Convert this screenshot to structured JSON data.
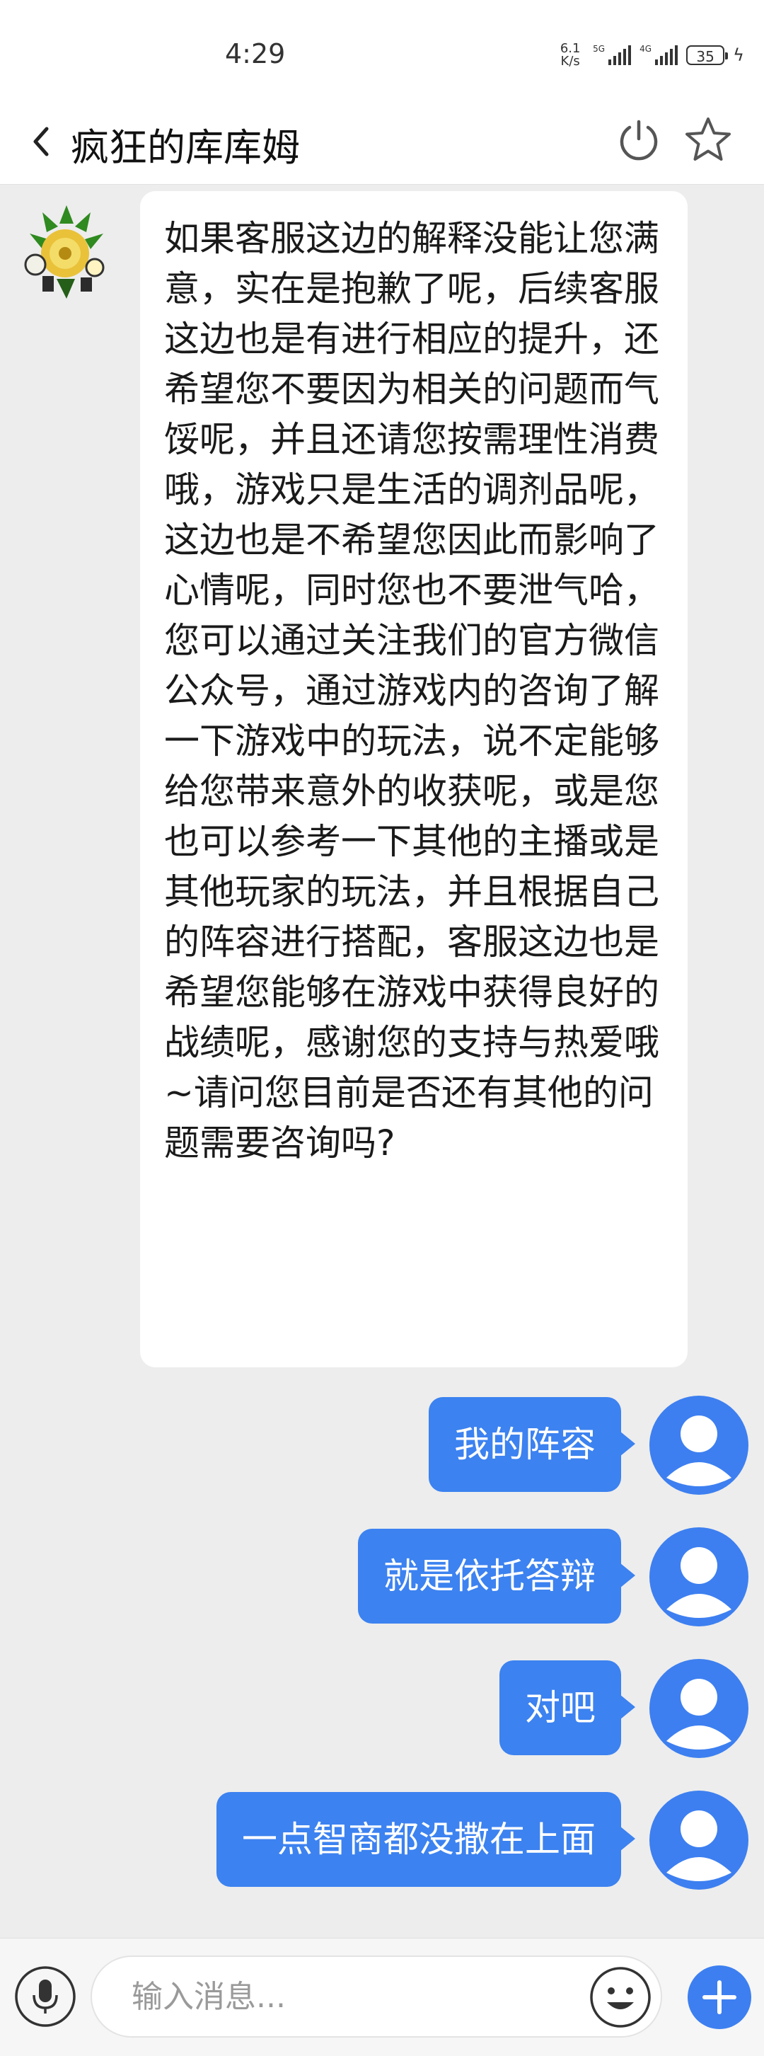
{
  "status_bar": {
    "time": "4:29",
    "net_speed_value": "6.1",
    "net_speed_unit": "K/s",
    "signal1_label": "5G",
    "signal2_label": "4G",
    "battery": "35"
  },
  "header": {
    "title": "疯狂的库库姆"
  },
  "messages": {
    "incoming_text": "如果客服这边的解释没能让您满意，实在是抱歉了呢，后续客服这边也是有进行相应的提升，还希望您不要因为相关的问题而气馁呢，并且还请您按需理性消费哦，游戏只是生活的调剂品呢，这边也是不希望您因此而影响了心情呢，同时您也不要泄气哈， 您可以通过关注我们的官方微信公众号，通过游戏内的咨询了解一下游戏中的玩法，说不定能够给您带来意外的收获呢，或是您也可以参考一下其他的主播或是其他玩家的玩法，并且根据自己的阵容进行搭配，客服这边也是希望您能够在游戏中获得良好的战绩呢，感谢您的支持与热爱哦~请问您目前是否还有其他的问题需要咨询吗?",
    "outgoing": [
      "我的阵容",
      "就是依托答辩",
      "对吧",
      "一点智商都没撒在上面"
    ]
  },
  "input_bar": {
    "placeholder": "输入消息..."
  },
  "colors": {
    "accent": "#3c82f0",
    "background": "#ededed",
    "avatar_blue": "#3d7ff0"
  }
}
